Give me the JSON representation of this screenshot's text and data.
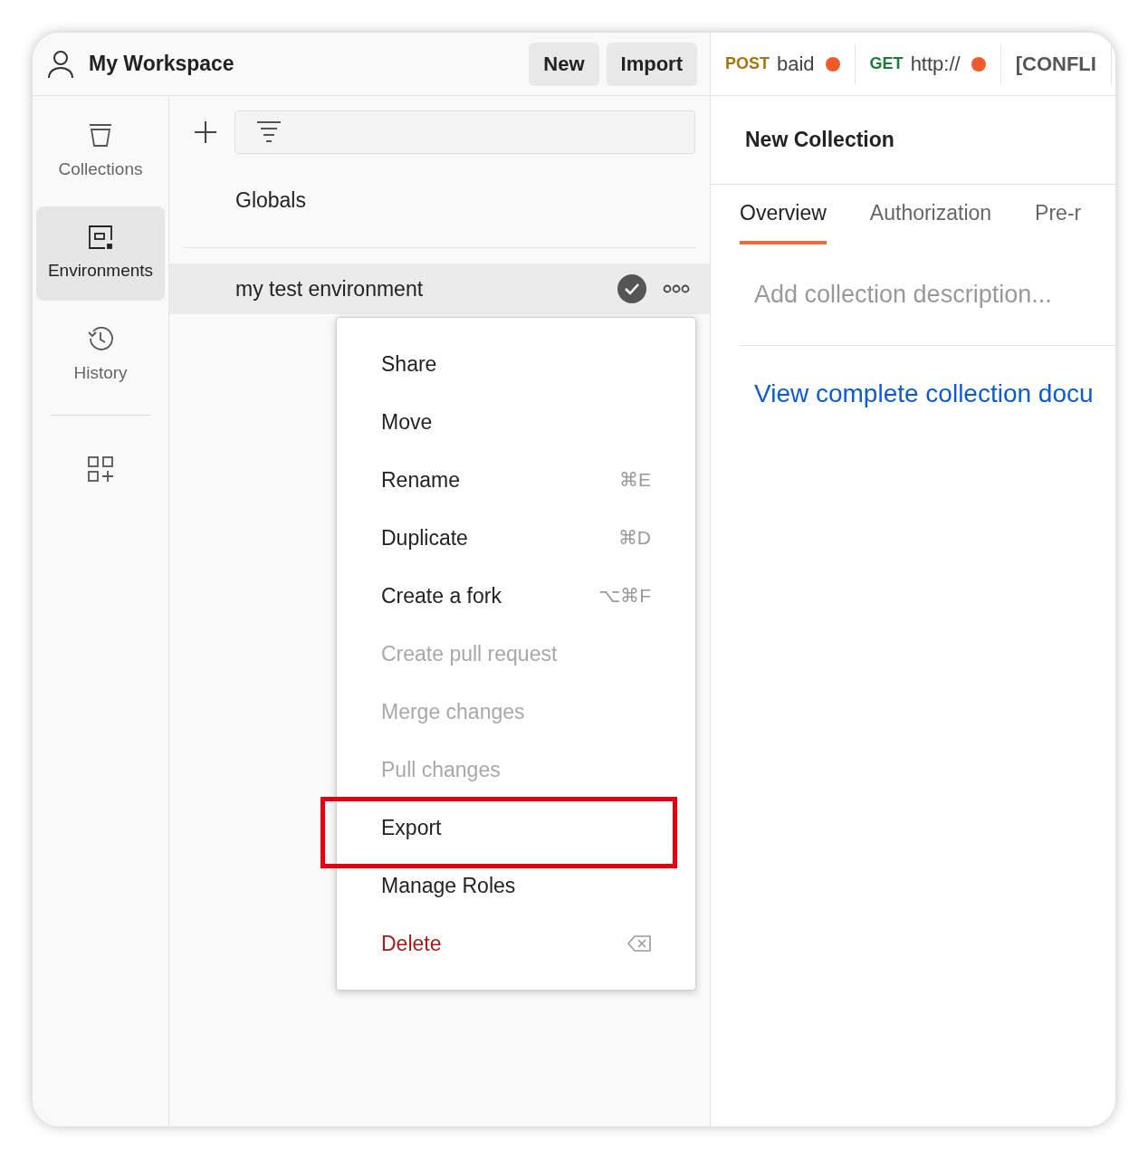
{
  "workspace": {
    "title": "My Workspace",
    "buttons": [
      "New",
      "Import"
    ]
  },
  "request_tabs": [
    {
      "method": "POST",
      "color": "#a8720c",
      "name": "baid",
      "unsaved": true
    },
    {
      "method": "GET",
      "color": "#1e7a36",
      "name": "http://",
      "unsaved": true
    },
    {
      "color": "#555555",
      "name": "[CONFLI",
      "unsaved": false
    }
  ],
  "sidebar": {
    "items": [
      {
        "kind": "collections",
        "label": "Collections",
        "selected": false
      },
      {
        "kind": "environments",
        "label": "Environments",
        "selected": true
      },
      {
        "kind": "history",
        "label": "History",
        "selected": false
      }
    ]
  },
  "environments": {
    "globals": "Globals",
    "items": [
      {
        "name": "my test environment",
        "active": true,
        "selected": true
      }
    ]
  },
  "context_menu": {
    "items": [
      {
        "label": "Share",
        "kind": "normal",
        "annotated": false
      },
      {
        "label": "Move",
        "kind": "normal",
        "annotated": false
      },
      {
        "label": "Rename",
        "kind": "normal",
        "shortcut": "⌘E",
        "annotated": false
      },
      {
        "label": "Duplicate",
        "kind": "normal",
        "shortcut": "⌘D",
        "annotated": false
      },
      {
        "label": "Create a fork",
        "kind": "normal",
        "shortcut": "⌥⌘F",
        "annotated": false
      },
      {
        "label": "Create pull request",
        "kind": "disabled",
        "annotated": false
      },
      {
        "label": "Merge changes",
        "kind": "disabled",
        "annotated": false
      },
      {
        "label": "Pull changes",
        "kind": "disabled",
        "annotated": false
      },
      {
        "label": "Export",
        "kind": "normal",
        "annotated": true
      },
      {
        "label": "Manage Roles",
        "kind": "normal",
        "annotated": false
      },
      {
        "label": "Delete",
        "kind": "danger",
        "backspace_shortcut": true,
        "annotated": false
      }
    ]
  },
  "collection": {
    "title": "New Collection",
    "tabs": [
      {
        "label": "Overview",
        "selected": true
      },
      {
        "label": "Authorization",
        "selected": false
      },
      {
        "label": "Pre-r",
        "selected": false
      }
    ],
    "description": {
      "placeholder": "Add collection description..."
    },
    "link": "View complete collection docu"
  }
}
